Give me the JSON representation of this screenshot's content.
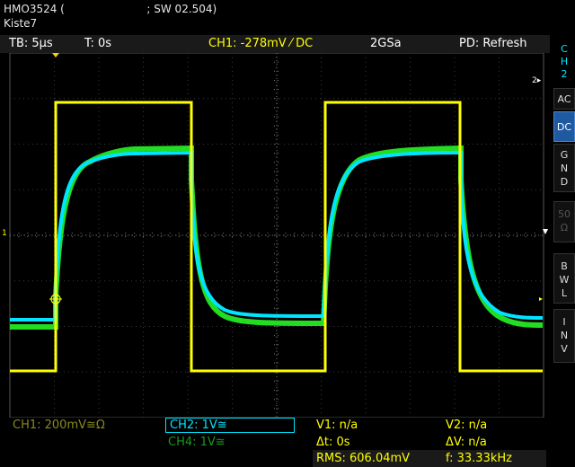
{
  "header": {
    "line1": "HMO3524 (                        ; SW 02.504)",
    "line2": "Kiste7"
  },
  "topbar": {
    "timebase": "TB: 5µs",
    "trigger_time": "T: 0s",
    "channel_setting": "CH1: -278mV ⁄ DC",
    "sample_rate": "2GSa",
    "mode": "PD: Refresh"
  },
  "sidebar": {
    "channel_label": "C\nH\n2",
    "buttons": [
      {
        "label": "AC",
        "active": false
      },
      {
        "label": "DC",
        "active": true
      },
      {
        "label": "G\nN\nD",
        "active": false
      },
      {
        "label": "50\nΩ",
        "active": false,
        "disabled": true
      },
      {
        "label": "B\nW\nL",
        "active": false
      },
      {
        "label": "I\nN\nV",
        "active": false
      }
    ]
  },
  "markers": {
    "ch2_right": "2▸",
    "ch1_left": "1"
  },
  "bottom": {
    "ch1": "CH1: 200mV≅Ω",
    "ch2": "CH2: 1V≅",
    "ch4": "CH4: 1V≅",
    "v1": "V1: n/a",
    "v2": "V2: n/a",
    "dt": "Δt: 0s",
    "dv": "ΔV: n/a",
    "rms": "RMS: 606.04mV",
    "freq": "f: 33.33kHz"
  },
  "colors": {
    "ch1": "#ffff00",
    "ch2": "#00e5ff",
    "ch4": "#22dd22",
    "grid": "#3a3a3a",
    "accent": "#1f5aa0"
  }
}
